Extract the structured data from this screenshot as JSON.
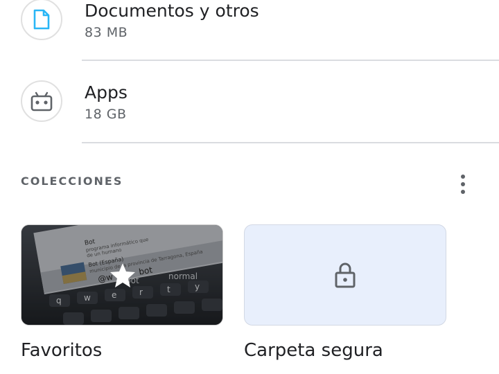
{
  "categories": [
    {
      "name": "Documentos y otros",
      "size": "83 MB",
      "icon": "document-icon"
    },
    {
      "name": "Apps",
      "size": "18 GB",
      "icon": "android-icon"
    }
  ],
  "collections": {
    "header": "COLECCIONES",
    "items": [
      {
        "label": "Favoritos",
        "icon": "star-icon"
      },
      {
        "label": "Carpeta segura",
        "icon": "lock-icon"
      }
    ]
  },
  "thumbnail": {
    "lines": [
      "Bot",
      "programa informático que",
      "de un humano",
      "Bot (España)",
      "municipio de la provincia de Tarragona, España",
      "@w",
      "bot",
      "bot",
      "normal"
    ],
    "keys": [
      "q",
      "w",
      "e",
      "r",
      "t",
      "y"
    ]
  },
  "colors": {
    "accent": "#1a73e8",
    "icon_fill": "#5f6368",
    "secure_bg": "#e8effc"
  }
}
